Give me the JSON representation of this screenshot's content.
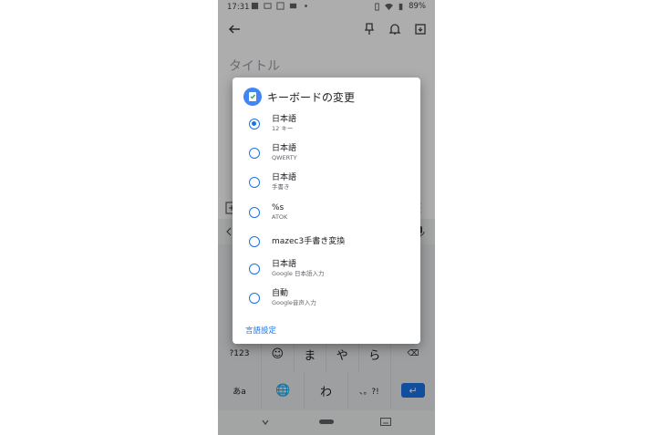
{
  "status_bar": {
    "time": "17:31",
    "battery": "89%"
  },
  "note": {
    "title_placeholder": "タイトル"
  },
  "keyboard": {
    "row1": [
      "?123",
      "☺",
      "ま",
      "や",
      "ら",
      "⌫"
    ],
    "row2": [
      "あa",
      "🌐",
      "わ",
      "、。?!",
      "↵"
    ]
  },
  "dialog": {
    "title": "キーボードの変更",
    "options": [
      {
        "label": "日本語",
        "sub": "12 キー",
        "selected": true
      },
      {
        "label": "日本語",
        "sub": "QWERTY",
        "selected": false
      },
      {
        "label": "日本語",
        "sub": "手書き",
        "selected": false
      },
      {
        "label": "%s",
        "sub": "ATOK",
        "selected": false
      },
      {
        "label": "mazec3手書き変換",
        "sub": "",
        "selected": false
      },
      {
        "label": "日本語",
        "sub": "Google 日本語入力",
        "selected": false
      },
      {
        "label": "自動",
        "sub": "Google音声入力",
        "selected": false
      }
    ],
    "footer_link": "言語設定"
  },
  "colors": {
    "accent": "#1a73e8",
    "scrim": "rgba(0,0,0,0.32)"
  }
}
